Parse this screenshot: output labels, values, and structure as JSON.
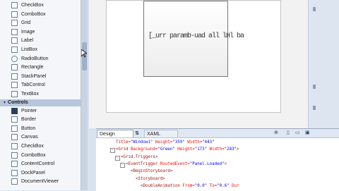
{
  "toolbox": {
    "items_top": [
      {
        "label": "CheckBox",
        "icon": "checkbox-icon"
      },
      {
        "label": "ComboBox",
        "icon": "combobox-icon"
      },
      {
        "label": "Grid",
        "icon": "grid-icon"
      },
      {
        "label": "Image",
        "icon": "image-icon"
      },
      {
        "label": "Label",
        "icon": "label-icon"
      },
      {
        "label": "ListBox",
        "icon": "listbox-icon"
      },
      {
        "label": "RadioButton",
        "icon": "radio-icon"
      },
      {
        "label": "Rectangle",
        "icon": "rectangle-icon"
      },
      {
        "label": "StackPanel",
        "icon": "stackpanel-icon"
      },
      {
        "label": "TabControl",
        "icon": "tabcontrol-icon"
      },
      {
        "label": "TextBox",
        "icon": "textbox-icon"
      }
    ],
    "section_header": "Controls",
    "items_bottom": [
      {
        "label": "Pointer",
        "icon": "pointer-icon"
      },
      {
        "label": "Border",
        "icon": "border-icon"
      },
      {
        "label": "Button",
        "icon": "button-icon"
      },
      {
        "label": "Canvas",
        "icon": "canvas-icon"
      },
      {
        "label": "CheckBox",
        "icon": "checkbox-icon"
      },
      {
        "label": "ComboBox",
        "icon": "combobox-icon"
      },
      {
        "label": "ContentControl",
        "icon": "contentcontrol-icon"
      },
      {
        "label": "DockPanel",
        "icon": "dockpanel-icon"
      },
      {
        "label": "DocumentViewer",
        "icon": "documentviewer-icon"
      }
    ]
  },
  "designer": {
    "window_text": "[_urr paramb-uad all lHl ba"
  },
  "editor": {
    "tab_design": "Design",
    "tab_xaml": "XAML",
    "swap_glyph": "⇅",
    "lines": [
      {
        "indent": 0,
        "parts": [
          "Title=",
          "\"Window1\"",
          " Height=",
          "\"359\"",
          " Width=",
          "\"443\""
        ]
      },
      {
        "indent": 0,
        "parts": [
          "<Grid",
          " Background=",
          "\"Green\"",
          " Height=",
          "\"173\"",
          " Width=",
          "\"283\"",
          ">"
        ]
      },
      {
        "indent": 1,
        "parts": [
          "<Grid.Triggers>"
        ]
      },
      {
        "indent": 2,
        "parts": [
          "<EventTrigger",
          " RoutedEvent=",
          "\"Panel.Loaded\"",
          ">"
        ]
      },
      {
        "indent": 3,
        "parts": [
          "<BeginStoryboard>"
        ]
      },
      {
        "indent": 4,
        "parts": [
          "<Storyboard>"
        ]
      },
      {
        "indent": 5,
        "parts": [
          "<DoubleAnimation",
          " From=",
          "\"0.0\"",
          " To=",
          "\"0.6\"",
          " Dur"
        ]
      }
    ]
  },
  "colors": {
    "accent": "#2a3f66",
    "header": "#b7c6db",
    "xaml_blue": "#0000ff",
    "xaml_red": "#ff0000",
    "xaml_brown": "#a31515"
  }
}
